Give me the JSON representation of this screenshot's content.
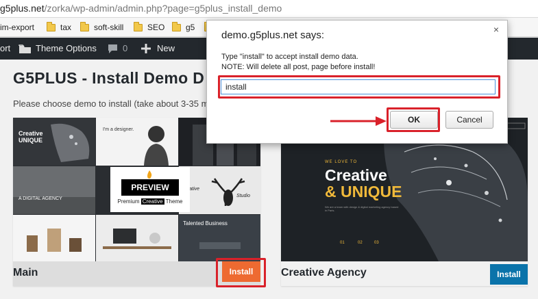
{
  "browser": {
    "url_host": "g5plus.net",
    "url_path": "/zorka/wp-admin/admin.php?page=g5plus_install_demo"
  },
  "bookmarks": [
    {
      "label": "im-export",
      "icon": "none"
    },
    {
      "label": "tax",
      "icon": "folder-icon"
    },
    {
      "label": "soft-skill",
      "icon": "folder-icon"
    },
    {
      "label": "SEO",
      "icon": "folder-icon"
    },
    {
      "label": "g5",
      "icon": "folder-icon"
    }
  ],
  "admin_bar": {
    "partial_item": "ort",
    "theme_options": "Theme Options",
    "comments_count": "0",
    "new_label": "New"
  },
  "page": {
    "title": "G5PLUS - Install Demo D",
    "description": "Please choose demo to install (take about 3-35 m"
  },
  "demos": [
    {
      "name": "Main",
      "install_label": "Install",
      "thumb_preview": "PREVIEW",
      "thumb_sub_left": "Premium",
      "thumb_sub_highlight": "Creative",
      "thumb_sub_right": "Theme",
      "thumb_texts": [
        "Creative",
        "UNIQUE",
        "I'm a designer.",
        "A DIGITAL AGENCY",
        "Creative",
        "Studio",
        "Talented Business"
      ],
      "button_color": "#ee6a31"
    },
    {
      "name": "Creative Agency",
      "install_label": "Install",
      "thumb_kicker": "WE LOVE TO",
      "thumb_title_1": "Creative",
      "thumb_title_2": "& UNIQUE",
      "thumb_body": "We are a team with design & digital marketing agency based in Paris.",
      "thumb_counters": [
        "01",
        "02",
        "03"
      ],
      "button_color": "#0a73aa"
    }
  ],
  "dialog": {
    "title": "demo.g5plus.net says:",
    "message_line_1": "Type \"install\" to accept install demo data.",
    "message_line_2": "NOTE: Will delete all post, page before install!",
    "input_value": "install",
    "ok_label": "OK",
    "cancel_label": "Cancel",
    "close_glyph": "×"
  },
  "icons": {
    "folder": "folder-icon",
    "comment": "comment-icon",
    "plus": "plus-icon",
    "close": "close-icon"
  },
  "colors": {
    "admin_bar": "#23282d",
    "annotation_red": "#d9212a",
    "install_orange": "#ee6a31",
    "install_blue": "#0a73aa"
  }
}
